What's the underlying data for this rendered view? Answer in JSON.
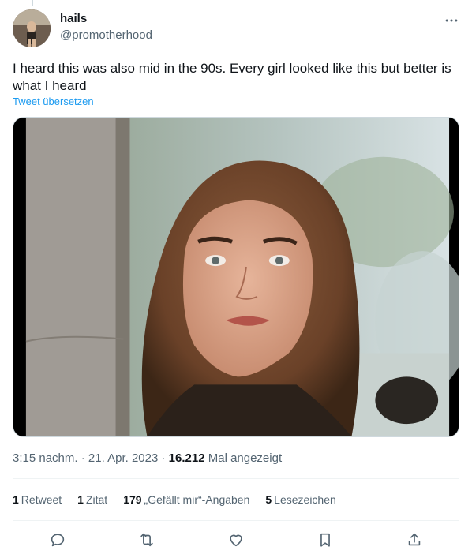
{
  "author": {
    "name": "hails",
    "handle": "@promotherhood"
  },
  "more_icon": "more-horizontal-icon",
  "tweet": {
    "text": "I heard this was also mid in the 90s. Every girl looked like this but better is what I heard",
    "translate_label": "Tweet übersetzen"
  },
  "meta": {
    "time": "3:15 nachm.",
    "sep1": " · ",
    "date": "21. Apr. 2023",
    "sep2": " · ",
    "views": "16.212",
    "views_label": " Mal angezeigt"
  },
  "stats": {
    "retweets_count": "1",
    "retweets_label": "Retweet",
    "quotes_count": "1",
    "quotes_label": "Zitat",
    "likes_count": "179",
    "likes_label": "„Gefällt mir“-Angaben",
    "bookmarks_count": "5",
    "bookmarks_label": "Lesezeichen"
  },
  "actions": [
    {
      "icon": "reply-icon"
    },
    {
      "icon": "retweet-icon"
    },
    {
      "icon": "like-icon"
    },
    {
      "icon": "bookmark-icon"
    },
    {
      "icon": "share-icon"
    }
  ],
  "colors": {
    "accent": "#1d9bf0",
    "secondary_text": "#536471",
    "primary_text": "#0f1419",
    "divider": "#eff3f4"
  }
}
